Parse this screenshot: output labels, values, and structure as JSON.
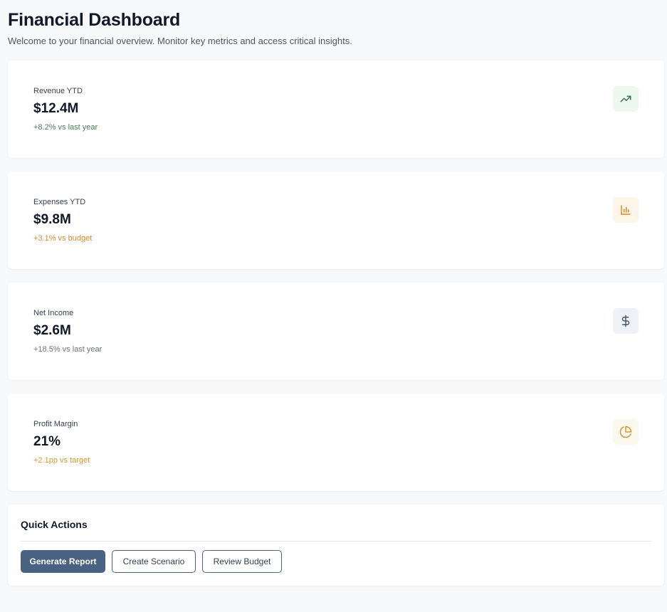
{
  "header": {
    "title": "Financial Dashboard",
    "subtitle": "Welcome to your financial overview. Monitor key metrics and access critical insights."
  },
  "metrics": [
    {
      "label": "Revenue YTD",
      "value": "$12.4M",
      "delta": "+8.2% vs last year",
      "icon": "trending-up-icon",
      "delta_color": "#4f7a5a",
      "icon_color": "#3f6f4c",
      "icon_bg": "#edf8ef"
    },
    {
      "label": "Expenses YTD",
      "value": "$9.8M",
      "delta": "+3.1% vs budget",
      "icon": "bar-chart-icon",
      "delta_color": "#d6862f",
      "icon_color": "#d98a2b",
      "icon_bg": "#fdf5e8"
    },
    {
      "label": "Net Income",
      "value": "$2.6M",
      "delta": "+18.5% vs last year",
      "icon": "dollar-icon",
      "delta_color": "#6b7280",
      "icon_color": "#4b5a6e",
      "icon_bg": "#eef1f5"
    },
    {
      "label": "Profit Margin",
      "value": "21%",
      "delta": "+2.1pp vs target",
      "icon": "pie-chart-icon",
      "delta_color": "#d4972f",
      "icon_color": "#d4972f",
      "icon_bg": "#fdf8ee"
    }
  ],
  "quick_actions": {
    "title": "Quick Actions",
    "buttons": [
      "Generate Report",
      "Create Scenario",
      "Review Budget"
    ]
  }
}
